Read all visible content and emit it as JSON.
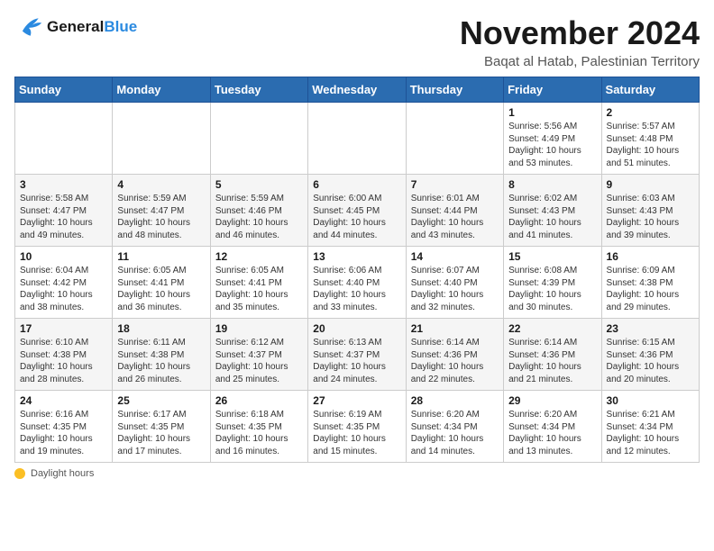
{
  "logo": {
    "line1": "General",
    "line2": "Blue"
  },
  "title": "November 2024",
  "subtitle": "Baqat al Hatab, Palestinian Territory",
  "days_of_week": [
    "Sunday",
    "Monday",
    "Tuesday",
    "Wednesday",
    "Thursday",
    "Friday",
    "Saturday"
  ],
  "weeks": [
    [
      {
        "day": "",
        "info": ""
      },
      {
        "day": "",
        "info": ""
      },
      {
        "day": "",
        "info": ""
      },
      {
        "day": "",
        "info": ""
      },
      {
        "day": "",
        "info": ""
      },
      {
        "day": "1",
        "info": "Sunrise: 5:56 AM\nSunset: 4:49 PM\nDaylight: 10 hours\nand 53 minutes."
      },
      {
        "day": "2",
        "info": "Sunrise: 5:57 AM\nSunset: 4:48 PM\nDaylight: 10 hours\nand 51 minutes."
      }
    ],
    [
      {
        "day": "3",
        "info": "Sunrise: 5:58 AM\nSunset: 4:47 PM\nDaylight: 10 hours\nand 49 minutes."
      },
      {
        "day": "4",
        "info": "Sunrise: 5:59 AM\nSunset: 4:47 PM\nDaylight: 10 hours\nand 48 minutes."
      },
      {
        "day": "5",
        "info": "Sunrise: 5:59 AM\nSunset: 4:46 PM\nDaylight: 10 hours\nand 46 minutes."
      },
      {
        "day": "6",
        "info": "Sunrise: 6:00 AM\nSunset: 4:45 PM\nDaylight: 10 hours\nand 44 minutes."
      },
      {
        "day": "7",
        "info": "Sunrise: 6:01 AM\nSunset: 4:44 PM\nDaylight: 10 hours\nand 43 minutes."
      },
      {
        "day": "8",
        "info": "Sunrise: 6:02 AM\nSunset: 4:43 PM\nDaylight: 10 hours\nand 41 minutes."
      },
      {
        "day": "9",
        "info": "Sunrise: 6:03 AM\nSunset: 4:43 PM\nDaylight: 10 hours\nand 39 minutes."
      }
    ],
    [
      {
        "day": "10",
        "info": "Sunrise: 6:04 AM\nSunset: 4:42 PM\nDaylight: 10 hours\nand 38 minutes."
      },
      {
        "day": "11",
        "info": "Sunrise: 6:05 AM\nSunset: 4:41 PM\nDaylight: 10 hours\nand 36 minutes."
      },
      {
        "day": "12",
        "info": "Sunrise: 6:05 AM\nSunset: 4:41 PM\nDaylight: 10 hours\nand 35 minutes."
      },
      {
        "day": "13",
        "info": "Sunrise: 6:06 AM\nSunset: 4:40 PM\nDaylight: 10 hours\nand 33 minutes."
      },
      {
        "day": "14",
        "info": "Sunrise: 6:07 AM\nSunset: 4:40 PM\nDaylight: 10 hours\nand 32 minutes."
      },
      {
        "day": "15",
        "info": "Sunrise: 6:08 AM\nSunset: 4:39 PM\nDaylight: 10 hours\nand 30 minutes."
      },
      {
        "day": "16",
        "info": "Sunrise: 6:09 AM\nSunset: 4:38 PM\nDaylight: 10 hours\nand 29 minutes."
      }
    ],
    [
      {
        "day": "17",
        "info": "Sunrise: 6:10 AM\nSunset: 4:38 PM\nDaylight: 10 hours\nand 28 minutes."
      },
      {
        "day": "18",
        "info": "Sunrise: 6:11 AM\nSunset: 4:38 PM\nDaylight: 10 hours\nand 26 minutes."
      },
      {
        "day": "19",
        "info": "Sunrise: 6:12 AM\nSunset: 4:37 PM\nDaylight: 10 hours\nand 25 minutes."
      },
      {
        "day": "20",
        "info": "Sunrise: 6:13 AM\nSunset: 4:37 PM\nDaylight: 10 hours\nand 24 minutes."
      },
      {
        "day": "21",
        "info": "Sunrise: 6:14 AM\nSunset: 4:36 PM\nDaylight: 10 hours\nand 22 minutes."
      },
      {
        "day": "22",
        "info": "Sunrise: 6:14 AM\nSunset: 4:36 PM\nDaylight: 10 hours\nand 21 minutes."
      },
      {
        "day": "23",
        "info": "Sunrise: 6:15 AM\nSunset: 4:36 PM\nDaylight: 10 hours\nand 20 minutes."
      }
    ],
    [
      {
        "day": "24",
        "info": "Sunrise: 6:16 AM\nSunset: 4:35 PM\nDaylight: 10 hours\nand 19 minutes."
      },
      {
        "day": "25",
        "info": "Sunrise: 6:17 AM\nSunset: 4:35 PM\nDaylight: 10 hours\nand 17 minutes."
      },
      {
        "day": "26",
        "info": "Sunrise: 6:18 AM\nSunset: 4:35 PM\nDaylight: 10 hours\nand 16 minutes."
      },
      {
        "day": "27",
        "info": "Sunrise: 6:19 AM\nSunset: 4:35 PM\nDaylight: 10 hours\nand 15 minutes."
      },
      {
        "day": "28",
        "info": "Sunrise: 6:20 AM\nSunset: 4:34 PM\nDaylight: 10 hours\nand 14 minutes."
      },
      {
        "day": "29",
        "info": "Sunrise: 6:20 AM\nSunset: 4:34 PM\nDaylight: 10 hours\nand 13 minutes."
      },
      {
        "day": "30",
        "info": "Sunrise: 6:21 AM\nSunset: 4:34 PM\nDaylight: 10 hours\nand 12 minutes."
      }
    ]
  ],
  "footer": {
    "label": "Daylight hours"
  },
  "colors": {
    "header_bg": "#2b6cb0",
    "accent": "#fbbf24"
  }
}
